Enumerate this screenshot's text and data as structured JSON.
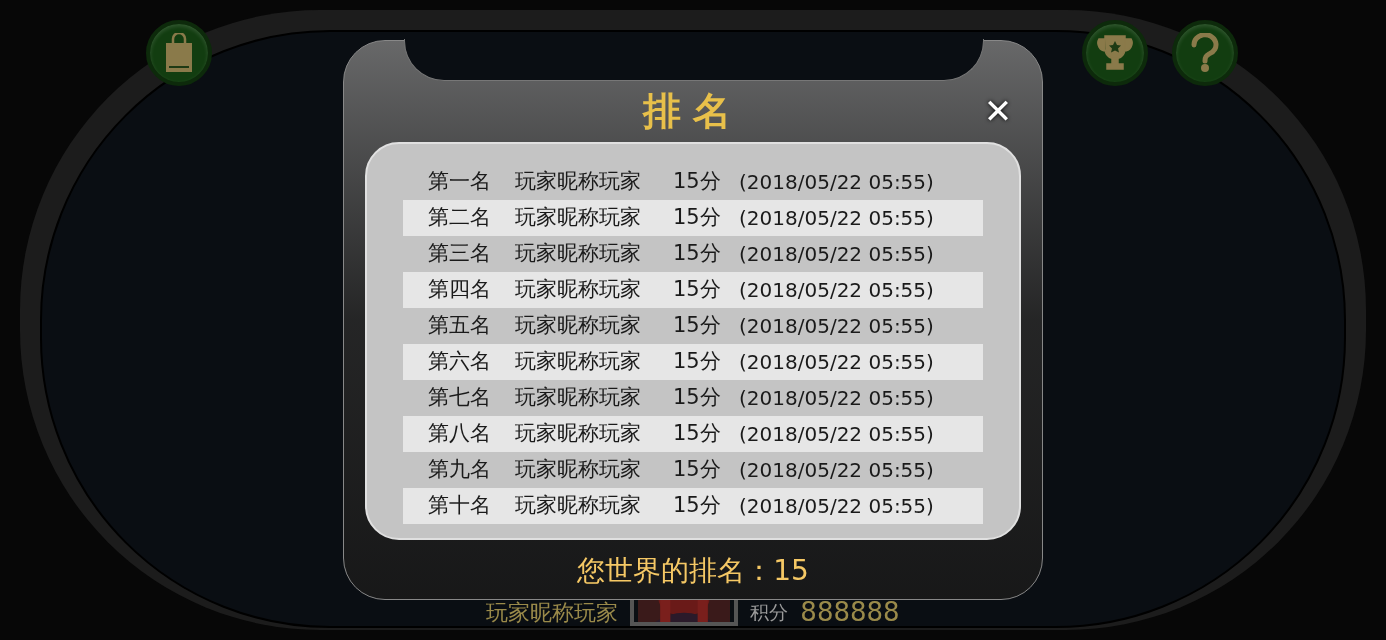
{
  "toolbar": {
    "buttons": [
      {
        "kind": "shop"
      },
      {
        "kind": "trophy"
      },
      {
        "kind": "help"
      }
    ]
  },
  "player": {
    "name": "玩家昵称玩家",
    "score_label": "积分",
    "score": "888888"
  },
  "dialog": {
    "title": "排名",
    "close": "✕",
    "rows": [
      {
        "rank": "第一名",
        "name": "玩家昵称玩家",
        "score": "15分",
        "time": "(2018/05/22 05:55)"
      },
      {
        "rank": "第二名",
        "name": "玩家昵称玩家",
        "score": "15分",
        "time": "(2018/05/22 05:55)"
      },
      {
        "rank": "第三名",
        "name": "玩家昵称玩家",
        "score": "15分",
        "time": "(2018/05/22 05:55)"
      },
      {
        "rank": "第四名",
        "name": "玩家昵称玩家",
        "score": "15分",
        "time": "(2018/05/22 05:55)"
      },
      {
        "rank": "第五名",
        "name": "玩家昵称玩家",
        "score": "15分",
        "time": "(2018/05/22 05:55)"
      },
      {
        "rank": "第六名",
        "name": "玩家昵称玩家",
        "score": "15分",
        "time": "(2018/05/22 05:55)"
      },
      {
        "rank": "第七名",
        "name": "玩家昵称玩家",
        "score": "15分",
        "time": "(2018/05/22 05:55)"
      },
      {
        "rank": "第八名",
        "name": "玩家昵称玩家",
        "score": "15分",
        "time": "(2018/05/22 05:55)"
      },
      {
        "rank": "第九名",
        "name": "玩家昵称玩家",
        "score": "15分",
        "time": "(2018/05/22 05:55)"
      },
      {
        "rank": "第十名",
        "name": "玩家昵称玩家",
        "score": "15分",
        "time": "(2018/05/22 05:55)"
      }
    ],
    "footer": "您世界的排名：15"
  }
}
